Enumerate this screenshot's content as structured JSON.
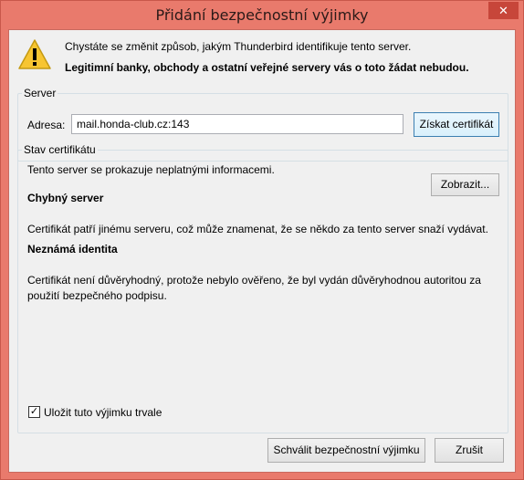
{
  "window": {
    "title": "Přidání bezpečnostní výjimky",
    "close_glyph": "✕"
  },
  "intro": {
    "icon": "warning-icon",
    "line1": "Chystáte se změnit způsob, jakým Thunderbird identifikuje tento server.",
    "line2": "Legitimní banky, obchody a ostatní veřejné servery vás o toto žádat nebudou."
  },
  "server": {
    "legend": "Server",
    "address_label": "Adresa:",
    "address_value": "mail.honda-club.cz:143",
    "get_certificate_label": "Získat certifikát"
  },
  "status": {
    "legend": "Stav certifikátu",
    "summary": "Tento server se prokazuje neplatnými informacemi.",
    "view_label": "Zobrazit...",
    "wrong_site_title": "Chybný server",
    "wrong_site_text": "Certifikát patří jinému serveru, což může znamenat, že se někdo za tento server snaží vydávat.",
    "unknown_identity_title": "Neznámá identita",
    "unknown_identity_text": "Certifikát není důvěryhodný, protože nebylo ověřeno, že byl vydán důvěryhodnou autoritou za použití bezpečného podpisu."
  },
  "permanent": {
    "checked": true,
    "check_glyph": "✓",
    "label": "Uložit tuto výjimku trvale"
  },
  "footer": {
    "approve_label": "Schválit bezpečnostní výjimku",
    "cancel_label": "Zrušit"
  }
}
